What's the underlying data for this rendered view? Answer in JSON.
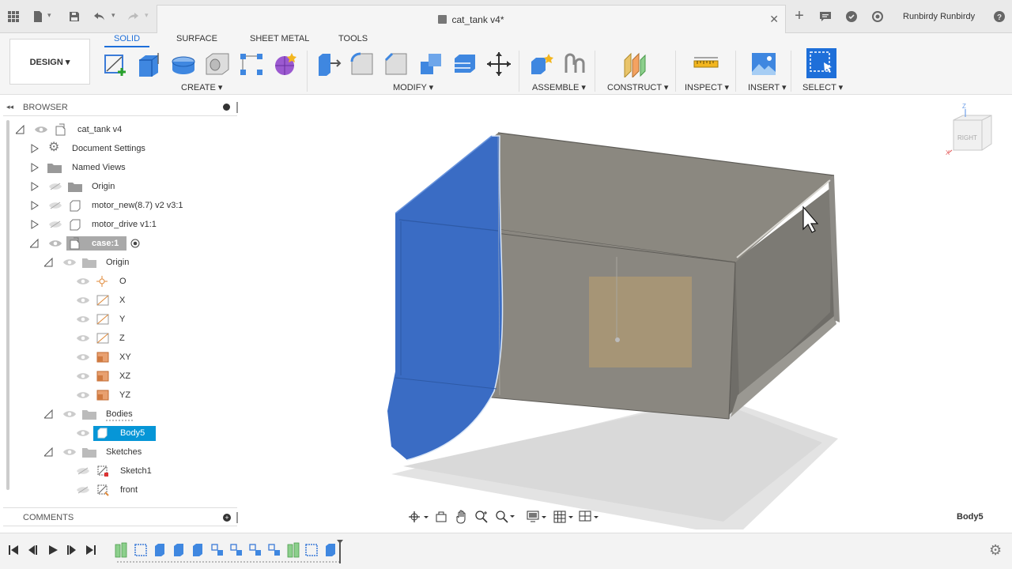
{
  "app": {
    "doc_title": "cat_tank v4*",
    "close_glyph": "✕",
    "user_name": "Runbirdy Runbirdy",
    "help_glyph": "?",
    "add_tab_glyph": "+"
  },
  "toolbar": {
    "workspace": "DESIGN",
    "tabs": [
      "SOLID",
      "SURFACE",
      "SHEET METAL",
      "TOOLS"
    ],
    "groups": {
      "create": "CREATE",
      "modify": "MODIFY",
      "assemble": "ASSEMBLE",
      "construct": "CONSTRUCT",
      "inspect": "INSPECT",
      "insert": "INSERT",
      "select": "SELECT"
    },
    "caret": "▾"
  },
  "browser": {
    "title": "BROWSER",
    "items": [
      {
        "label": "cat_tank v4"
      },
      {
        "label": "Document Settings"
      },
      {
        "label": "Named Views"
      },
      {
        "label": "Origin"
      },
      {
        "label": "motor_new(8.7) v2 v3:1"
      },
      {
        "label": "motor_drive v1:1"
      },
      {
        "label": "case:1"
      },
      {
        "label": "Origin"
      },
      {
        "label": "O"
      },
      {
        "label": "X"
      },
      {
        "label": "Y"
      },
      {
        "label": "Z"
      },
      {
        "label": "XY"
      },
      {
        "label": "XZ"
      },
      {
        "label": "YZ"
      },
      {
        "label": "Bodies"
      },
      {
        "label": "Body5"
      },
      {
        "label": "Sketches"
      },
      {
        "label": "Sketch1"
      },
      {
        "label": "front"
      }
    ]
  },
  "comments": {
    "title": "COMMENTS"
  },
  "viewcube": {
    "face": "RIGHT",
    "axis_z": "Z",
    "axis_x": "X"
  },
  "status": {
    "selection": "Body5"
  },
  "colors": {
    "accent": "#1e6fd9",
    "body_blue": "#3a6cc4",
    "body_gray": "#8a8880"
  }
}
